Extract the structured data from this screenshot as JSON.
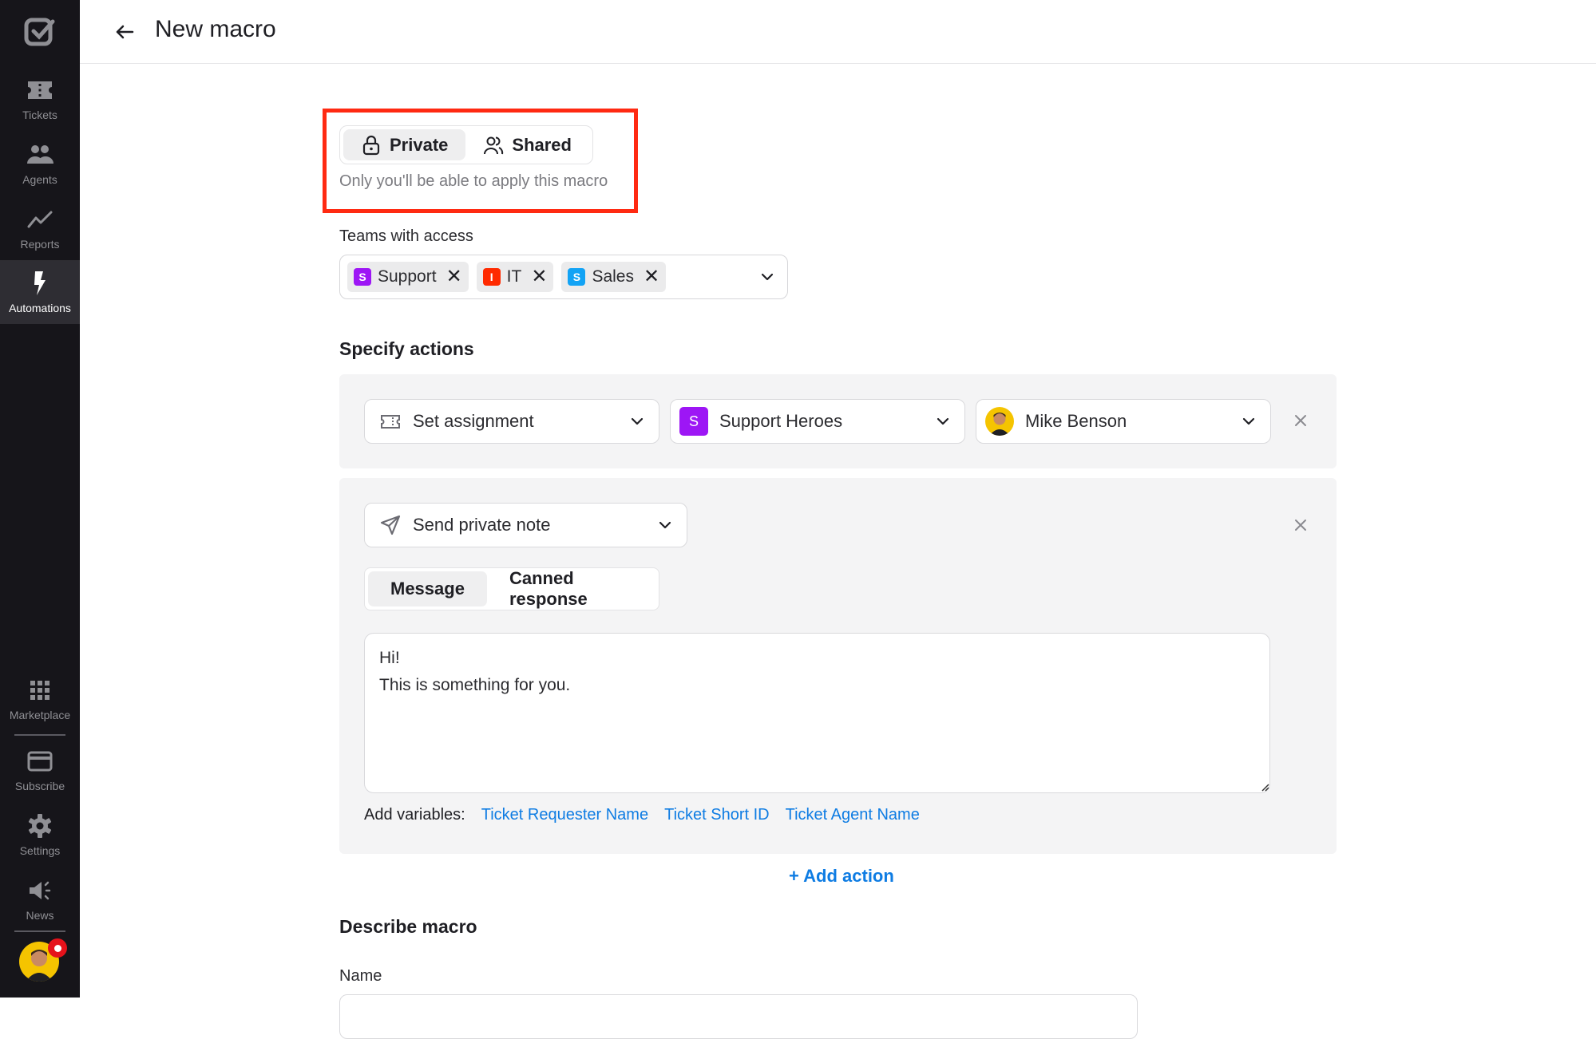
{
  "sidebar": {
    "logo_icon": "checkbox-logo-icon",
    "items": [
      {
        "label": "Tickets",
        "icon": "ticket-icon",
        "active": false
      },
      {
        "label": "Agents",
        "icon": "users-icon",
        "active": false
      },
      {
        "label": "Reports",
        "icon": "trend-line-icon",
        "active": false
      },
      {
        "label": "Automations",
        "icon": "lightning-icon",
        "active": true
      }
    ],
    "bottom_items": [
      {
        "label": "Marketplace",
        "icon": "grid-icon"
      },
      {
        "label": "Subscribe",
        "icon": "credit-card-icon"
      },
      {
        "label": "Settings",
        "icon": "gear-icon"
      },
      {
        "label": "News",
        "icon": "megaphone-icon"
      }
    ],
    "user_avatar": "user-avatar",
    "has_notification": true
  },
  "header": {
    "back_icon": "arrow-left-icon",
    "title": "New macro"
  },
  "visibility": {
    "options": [
      {
        "label": "Private",
        "icon": "lock-icon",
        "selected": true
      },
      {
        "label": "Shared",
        "icon": "users-outline-icon",
        "selected": false
      }
    ],
    "hint": "Only you'll be able to apply this macro"
  },
  "teams": {
    "label": "Teams with access",
    "chips": [
      {
        "initial": "S",
        "label": "Support",
        "color": "#9d16f5"
      },
      {
        "initial": "I",
        "label": "IT",
        "color": "#ff2a00"
      },
      {
        "initial": "S",
        "label": "Sales",
        "color": "#12a3f5"
      }
    ]
  },
  "actions": {
    "title": "Specify actions",
    "items": [
      {
        "type": "Set assignment",
        "type_icon": "ticket-outline-icon",
        "team": {
          "initial": "S",
          "label": "Support Heroes",
          "color": "#9d16f5"
        },
        "agent": {
          "label": "Mike Benson",
          "avatar": "agent-avatar"
        }
      },
      {
        "type": "Send private note",
        "type_icon": "send-icon",
        "tabs": [
          {
            "label": "Message",
            "selected": true
          },
          {
            "label": "Canned response",
            "selected": false
          }
        ],
        "message": "Hi!\nThis is something for you.",
        "variables_label": "Add variables:",
        "variables": [
          "Ticket Requester Name",
          "Ticket Short ID",
          "Ticket Agent Name"
        ]
      }
    ],
    "add_label": "+ Add action"
  },
  "describe": {
    "title": "Describe macro",
    "name_label": "Name",
    "name_value": ""
  },
  "colors": {
    "accent_link": "#0e7ce3",
    "highlight": "#ff2a12",
    "sidebar_bg": "#16151a"
  }
}
